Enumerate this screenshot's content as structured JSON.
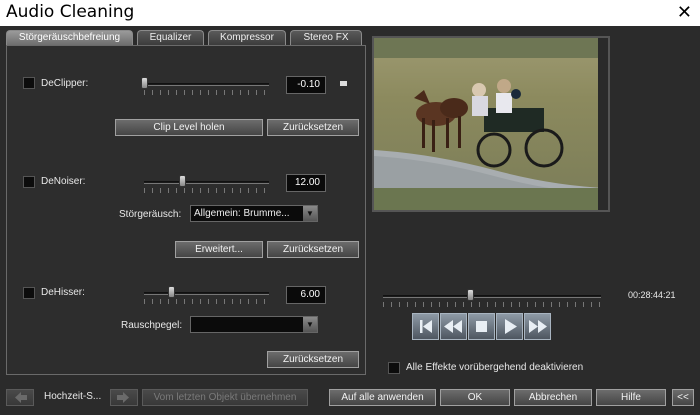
{
  "window": {
    "title": "Audio Cleaning",
    "close_glyph": "✕"
  },
  "tabs": [
    {
      "label": "Störgeräuschbefreiung",
      "active": true
    },
    {
      "label": "Equalizer",
      "active": false
    },
    {
      "label": "Kompressor",
      "active": false
    },
    {
      "label": "Stereo FX",
      "active": false
    }
  ],
  "declipper": {
    "label": "DeClipper:",
    "value": "-0.10",
    "slider_fraction": 0.0,
    "clip_button": "Clip Level holen",
    "reset_button": "Zurücksetzen"
  },
  "denoiser": {
    "label": "DeNoiser:",
    "value": "12.00",
    "slider_fraction": 0.3,
    "noise_label": "Störgeräusch:",
    "noise_value": "Allgemein: Brumme...",
    "advanced_button": "Erweitert...",
    "reset_button": "Zurücksetzen"
  },
  "dehisser": {
    "label": "DeHisser:",
    "value": "6.00",
    "slider_fraction": 0.2,
    "level_label": "Rauschpegel:",
    "level_value": "",
    "reset_button": "Zurücksetzen"
  },
  "player": {
    "timecode": "00:28:44:21",
    "position_fraction": 0.4,
    "disable_effects_label": "Alle Effekte vorübergehend deaktivieren"
  },
  "bottom": {
    "object_name": "Hochzeit-S...",
    "take_over_button": "Vom letzten Objekt übernehmen",
    "apply_all_button": "Auf alle anwenden",
    "ok_button": "OK",
    "cancel_button": "Abbrechen",
    "help_button": "Hilfe",
    "collapse_button": "<<"
  },
  "colors": {
    "background": "#2b2b2b",
    "titlebar": "#ffffff"
  }
}
